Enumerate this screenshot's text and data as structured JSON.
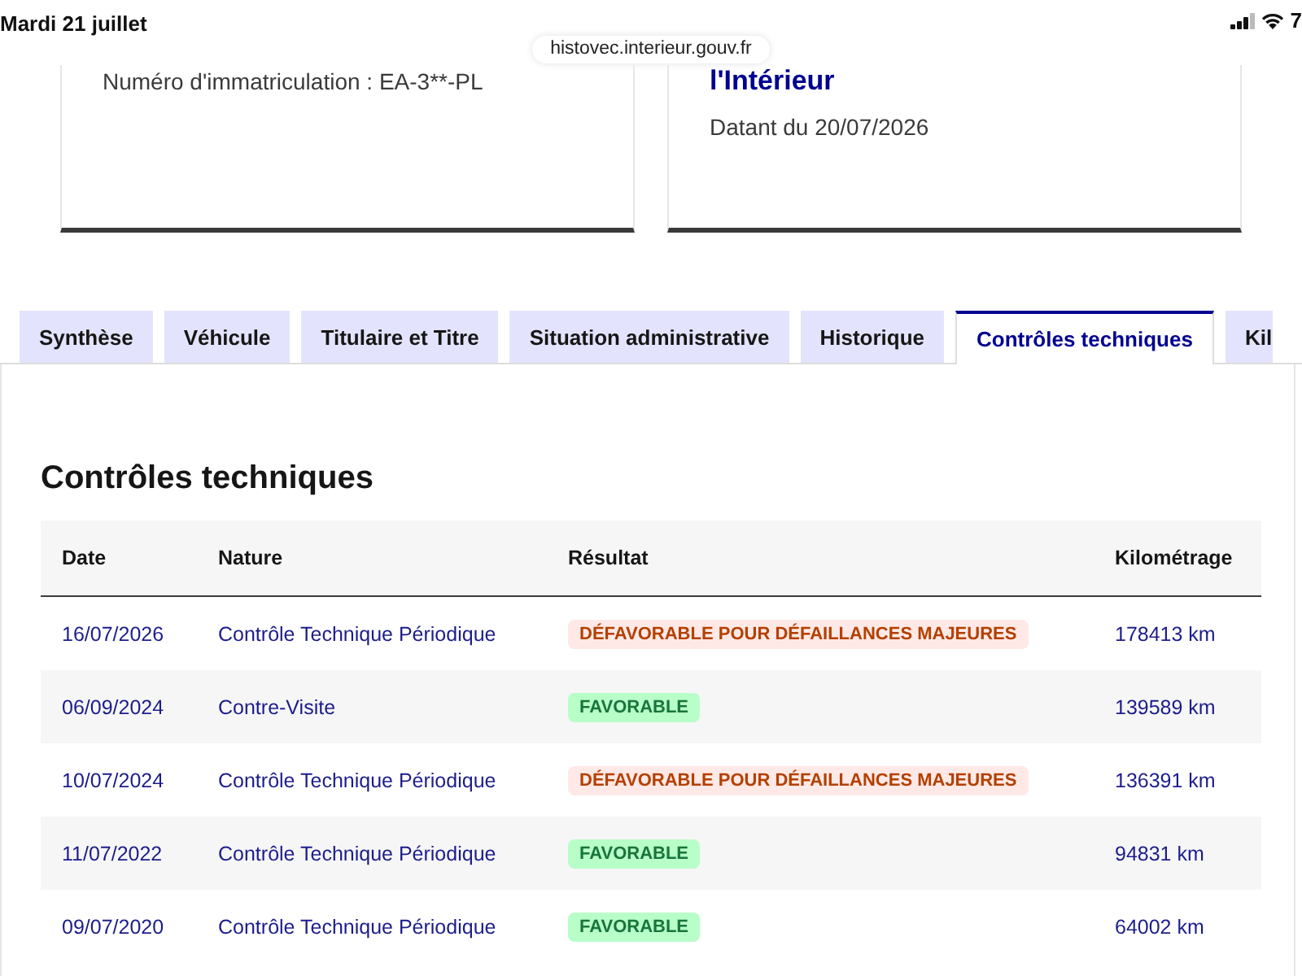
{
  "status_bar": {
    "date": "Mardi 21 juillet",
    "battery": "7"
  },
  "address_bar": {
    "url": "histovec.interieur.gouv.fr"
  },
  "cards": [
    {
      "text": "Numéro d'immatriculation : EA-3**-PL"
    },
    {
      "title": "l'Intérieur",
      "text": "Datant du 20/07/2026"
    }
  ],
  "tabs": [
    {
      "label": "Synthèse",
      "selected": false
    },
    {
      "label": "Véhicule",
      "selected": false
    },
    {
      "label": "Titulaire et Titre",
      "selected": false
    },
    {
      "label": "Situation administrative",
      "selected": false
    },
    {
      "label": "Historique",
      "selected": false
    },
    {
      "label": "Contrôles techniques",
      "selected": true
    },
    {
      "label": "Kil",
      "selected": false
    }
  ],
  "section": {
    "title": "Contrôles techniques",
    "table": {
      "columns": [
        "Date",
        "Nature",
        "Résultat",
        "Kilométrage"
      ],
      "rows": [
        {
          "date": "16/07/2026",
          "nature": "Contrôle Technique Périodique",
          "result": {
            "label": "DÉFAVORABLE POUR DÉFAILLANCES MAJEURES",
            "kind": "error"
          },
          "mileage": "178413 km"
        },
        {
          "date": "06/09/2024",
          "nature": "Contre-Visite",
          "result": {
            "label": "FAVORABLE",
            "kind": "success"
          },
          "mileage": "139589 km"
        },
        {
          "date": "10/07/2024",
          "nature": "Contrôle Technique Périodique",
          "result": {
            "label": "DÉFAVORABLE POUR DÉFAILLANCES MAJEURES",
            "kind": "error"
          },
          "mileage": "136391 km"
        },
        {
          "date": "11/07/2022",
          "nature": "Contrôle Technique Périodique",
          "result": {
            "label": "FAVORABLE",
            "kind": "success"
          },
          "mileage": "94831 km"
        },
        {
          "date": "09/07/2020",
          "nature": "Contrôle Technique Périodique",
          "result": {
            "label": "FAVORABLE",
            "kind": "success"
          },
          "mileage": "64002 km"
        }
      ]
    }
  }
}
